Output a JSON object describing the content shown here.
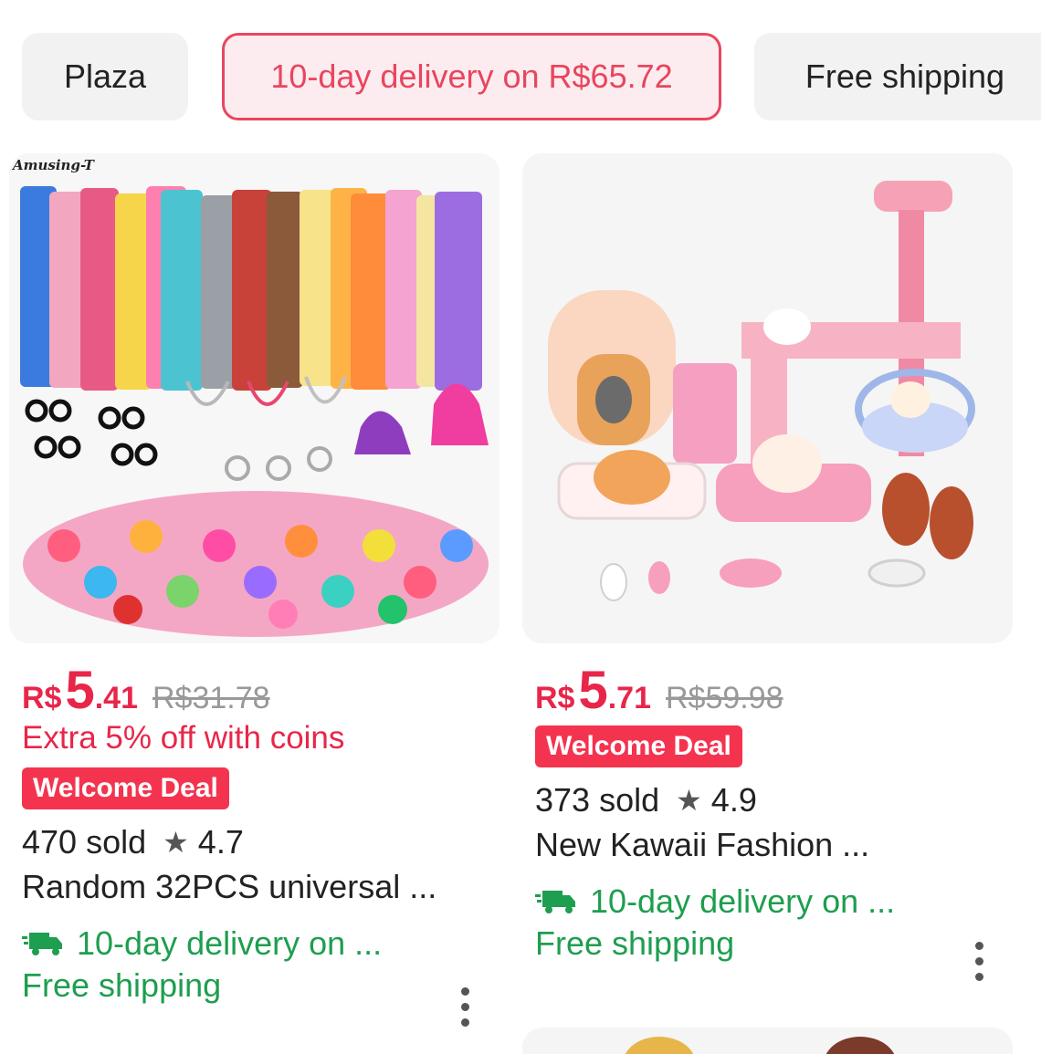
{
  "filters": [
    {
      "label": "Plaza",
      "active": false
    },
    {
      "label": "10-day delivery on R$65.72",
      "active": true
    },
    {
      "label": "Free shipping",
      "active": false
    }
  ],
  "products": [
    {
      "brand_mark": "Amusing-T",
      "currency": "R$",
      "price_int": "5",
      "price_dec": ".41",
      "original_price": "R$31.78",
      "coins_text": "Extra 5% off with coins",
      "badge": "Welcome Deal",
      "sold": "470 sold",
      "rating": "4.7",
      "title": "Random 32PCS universal ...",
      "delivery": "10-day delivery on ...",
      "shipping": "Free shipping"
    },
    {
      "currency": "R$",
      "price_int": "5",
      "price_dec": ".71",
      "original_price": "R$59.98",
      "badge": "Welcome Deal",
      "sold": "373 sold",
      "rating": "4.9",
      "title": "New Kawaii Fashion ...",
      "delivery": "10-day delivery on ...",
      "shipping": "Free shipping"
    }
  ],
  "colors": {
    "price_red": "#e8264a",
    "badge_red": "#f4334f",
    "shipping_green": "#1e9e4f",
    "chip_active": "#e8465f"
  },
  "icons": [
    "star-icon",
    "truck-icon",
    "more-options-icon"
  ]
}
